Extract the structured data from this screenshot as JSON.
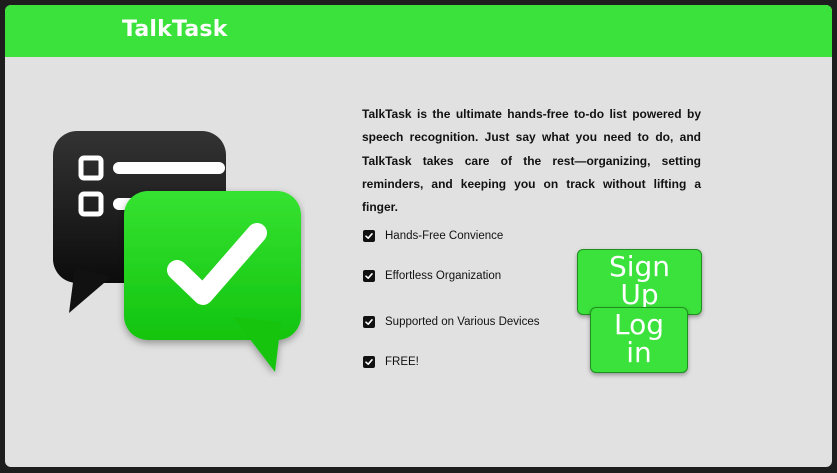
{
  "header": {
    "brand": "TalkTask"
  },
  "hero": {
    "icon": "chat-checklist-check-icon",
    "description": "TalkTask is the ultimate hands-free to-do list powered by speech recognition. Just say what you need to do, and TalkTask takes care of the rest—organizing, setting reminders, and keeping you on track without lifting a finger."
  },
  "features": [
    {
      "label": "Hands-Free Convience",
      "checked": true
    },
    {
      "label": "Effortless Organization",
      "checked": true
    },
    {
      "label": "Supported on Various Devices",
      "checked": true
    },
    {
      "label": "FREE!",
      "checked": true
    }
  ],
  "actions": {
    "sign_up_label": "Sign Up",
    "log_in_label": "Log in"
  },
  "colors": {
    "accent": "#3be23b",
    "background": "#e1e1e1",
    "frame": "#1e1e1e"
  }
}
